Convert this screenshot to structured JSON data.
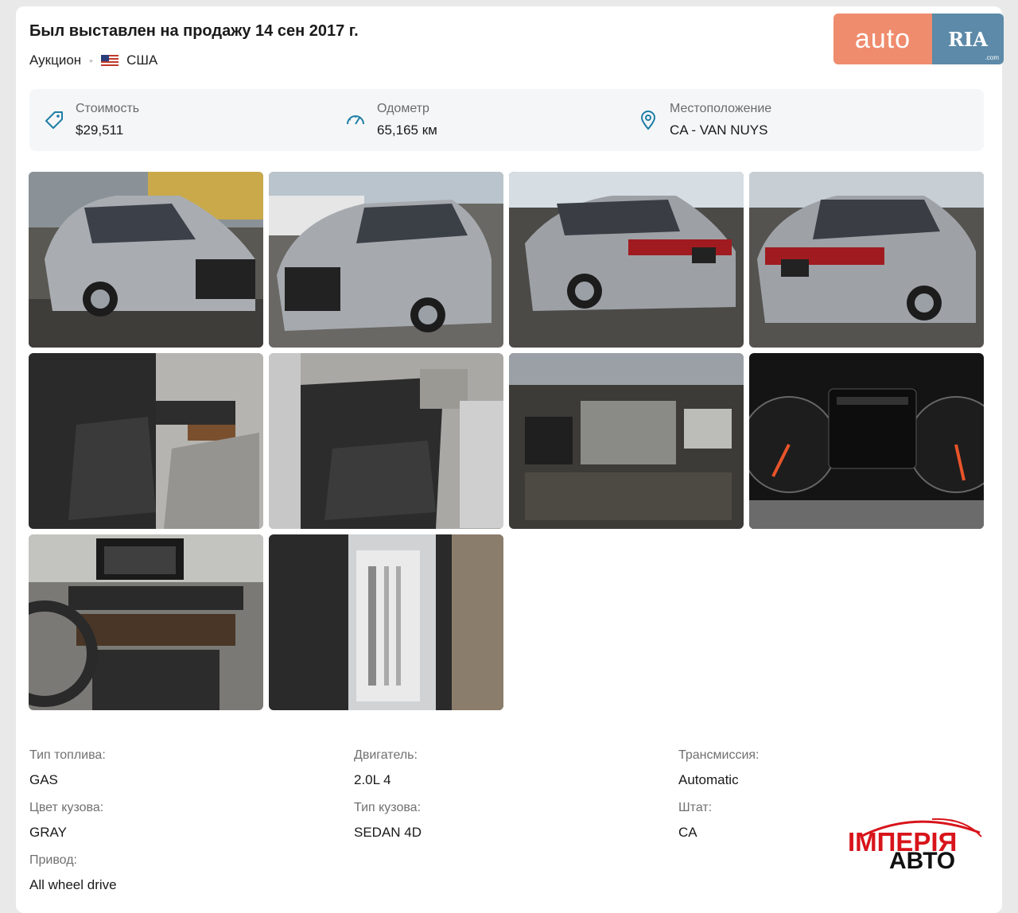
{
  "header": {
    "title": "Был выставлен на продажу 14 сен 2017 г.",
    "sale_type": "Аукцион",
    "country": "США"
  },
  "logo": {
    "left_text": "auto",
    "right_text": "RIA",
    "domain": ".com",
    "left_color": "#ef8c6e",
    "right_color": "#5c8aa8"
  },
  "stats": [
    {
      "label": "Стоимость",
      "value": "$29,511",
      "icon": "price-tag-icon"
    },
    {
      "label": "Одометр",
      "value": "65,165 км",
      "icon": "odometer-icon"
    },
    {
      "label": "Местоположение",
      "value": "CA - VAN NUYS",
      "icon": "location-pin-icon"
    }
  ],
  "photos": [
    "front-left-exterior",
    "front-right-exterior",
    "rear-left-exterior",
    "rear-right-exterior",
    "front-interior",
    "rear-seats-interior",
    "engine-bay",
    "instrument-cluster",
    "dashboard-console",
    "door-jamb-label"
  ],
  "details": [
    {
      "label": "Тип топлива:",
      "value": "GAS"
    },
    {
      "label": "Двигатель:",
      "value": "2.0L 4"
    },
    {
      "label": "Трансмиссия:",
      "value": "Automatic"
    },
    {
      "label": "Цвет кузова:",
      "value": "GRAY"
    },
    {
      "label": "Тип кузова:",
      "value": "SEDAN 4D"
    },
    {
      "label": "Штат:",
      "value": "CA"
    },
    {
      "label": "Привод:",
      "value": "All wheel drive"
    }
  ],
  "watermark": {
    "line1": "ІМПЕРІЯ",
    "line2": "АВТО",
    "color": "#d8141b"
  }
}
